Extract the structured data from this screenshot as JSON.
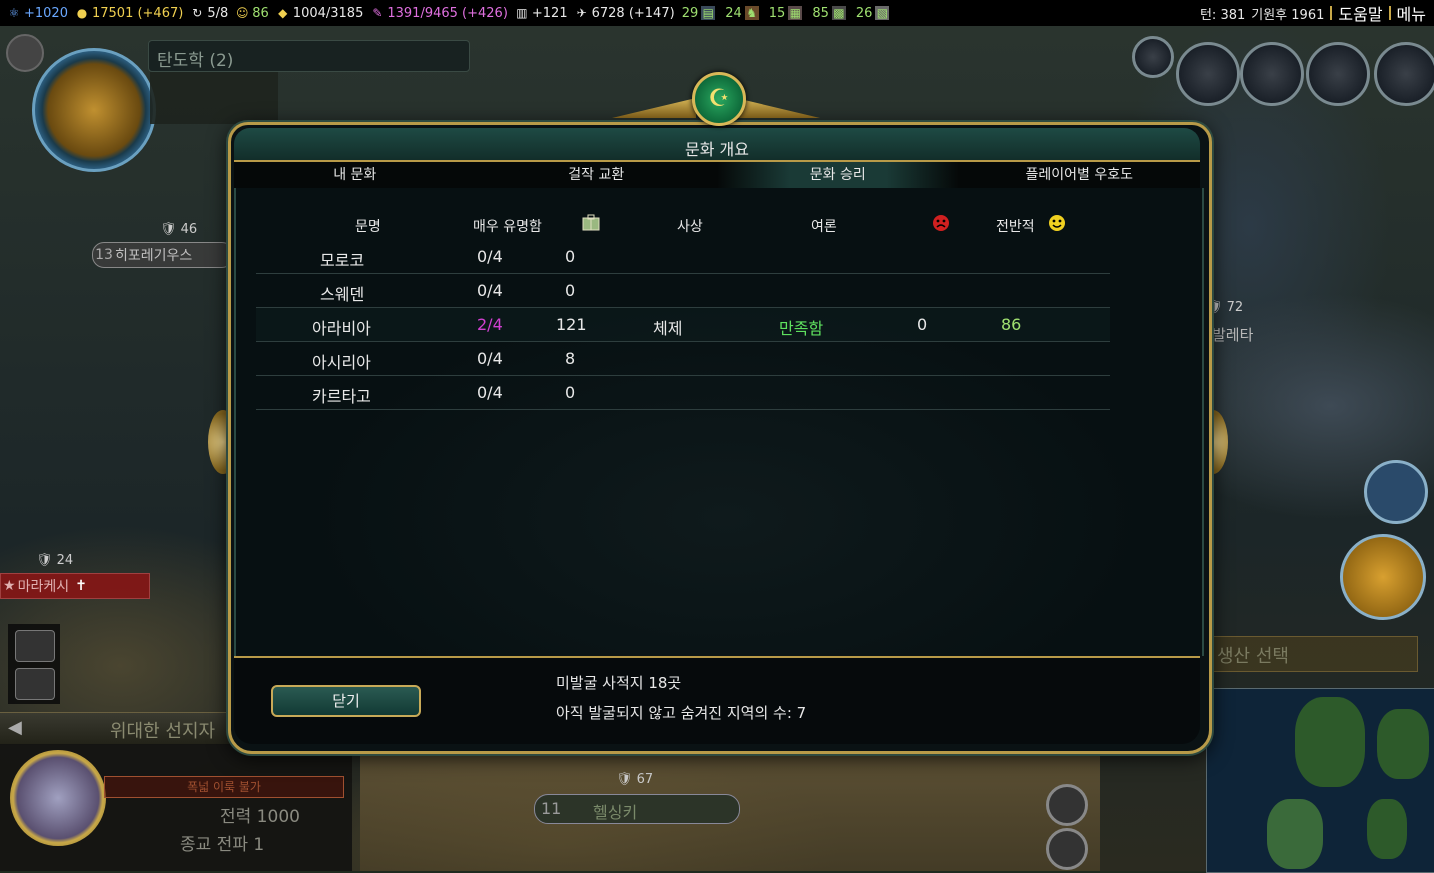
{
  "topbar": {
    "science": "+1020",
    "gold": "17501 (+467)",
    "trade_routes": "5/8",
    "happiness": "86",
    "golden_age": "1004/3185",
    "culture": "1391/9465 (+426)",
    "tourism": "+121",
    "faith": "6728 (+147)",
    "resources": [
      {
        "value": "29",
        "color": "#9fe070",
        "icon": "resource-icon"
      },
      {
        "value": "24",
        "color": "#9fe070",
        "icon": "horse-icon"
      },
      {
        "value": "15",
        "color": "#9fe070",
        "icon": "iron-icon"
      },
      {
        "value": "85",
        "color": "#9fe070",
        "icon": "coal-icon"
      },
      {
        "value": "26",
        "color": "#9fe070",
        "icon": "oil-icon"
      }
    ],
    "turn_label": "턴: 381",
    "year_label": "기원후 1961",
    "help_label": "도움말",
    "menu_label": "메뉴"
  },
  "game": {
    "tech_label": "탄도학 (2)",
    "city_left": {
      "num": "13",
      "name": "히포레기우스",
      "defense": "46"
    },
    "city_left2": {
      "name": "마라케시",
      "defense": "24"
    },
    "city_right": {
      "name": "발레타",
      "defense": "72"
    },
    "city_bottom": {
      "num": "11",
      "name": "헬싱키",
      "defense": "67"
    },
    "great_person_bar": "위대한 선지자",
    "unit_stat_strength": "전력   1000",
    "unit_stat_religion": "종교 전파     1",
    "unit_red_label": "폭넓 이룩 불가",
    "production_label": "생산 선택"
  },
  "dialog": {
    "title": "문화 개요",
    "tabs": [
      "내 문화",
      "걸작 교환",
      "문화 승리",
      "플레이어별 우호도"
    ],
    "active_tab": "문화 승리",
    "columns": {
      "civ": "문명",
      "influential": "매우 유명함",
      "tourism_icon": "tourism-icon",
      "ideology": "사상",
      "opinion": "여론",
      "unhappy_icon": "unhappy-face-icon",
      "overall": "전반적",
      "happy_icon": "happy-face-icon"
    },
    "rows": [
      {
        "civ": "모로코",
        "influential": "0/4",
        "tourism": "0",
        "ideology": "",
        "opinion": "",
        "unhappy": "",
        "overall": ""
      },
      {
        "civ": "스웨덴",
        "influential": "0/4",
        "tourism": "0",
        "ideology": "",
        "opinion": "",
        "unhappy": "",
        "overall": ""
      },
      {
        "civ": "아라비아",
        "influential": "2/4",
        "tourism": "121",
        "ideology": "체제",
        "opinion": "만족함",
        "unhappy": "0",
        "overall": "86"
      },
      {
        "civ": "아시리아",
        "influential": "0/4",
        "tourism": "8",
        "ideology": "",
        "opinion": "",
        "unhappy": "",
        "overall": ""
      },
      {
        "civ": "카르타고",
        "influential": "0/4",
        "tourism": "0",
        "ideology": "",
        "opinion": "",
        "unhappy": "",
        "overall": ""
      }
    ],
    "colors": {
      "influential_highlight": "#d040d0",
      "opinion_highlight": "#5ee05e",
      "overall_highlight": "#a0e070"
    },
    "footer": {
      "close_label": "닫기",
      "antiquity_sites": "미발굴 사적지 18곳",
      "hidden_sites": "아직 발굴되지 않고 숨겨진 지역의 수: 7"
    }
  }
}
